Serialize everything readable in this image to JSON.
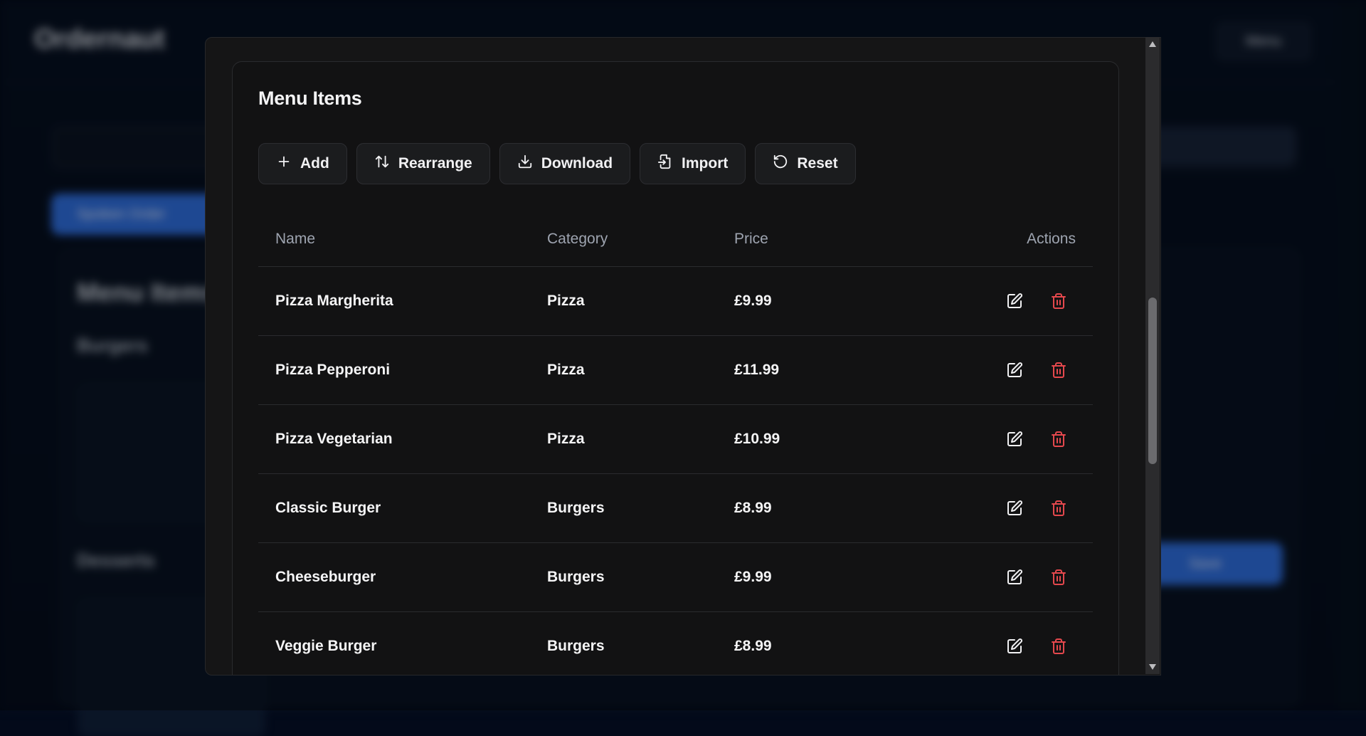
{
  "background": {
    "logo": "Ordernaut",
    "menu_button": "Menu",
    "spoken_order_button": "Spoken Order",
    "panel_title": "Menu Items",
    "sections": [
      "Burgers",
      "Desserts"
    ],
    "save_button": "Save"
  },
  "modal": {
    "title": "Menu Items",
    "toolbar": {
      "add": "Add",
      "rearrange": "Rearrange",
      "download": "Download",
      "import": "Import",
      "reset": "Reset"
    },
    "table": {
      "headers": {
        "name": "Name",
        "category": "Category",
        "price": "Price",
        "actions": "Actions"
      },
      "rows": [
        {
          "name": "Pizza Margherita",
          "category": "Pizza",
          "price": "£9.99"
        },
        {
          "name": "Pizza Pepperoni",
          "category": "Pizza",
          "price": "£11.99"
        },
        {
          "name": "Pizza Vegetarian",
          "category": "Pizza",
          "price": "£10.99"
        },
        {
          "name": "Classic Burger",
          "category": "Burgers",
          "price": "£8.99"
        },
        {
          "name": "Cheeseburger",
          "category": "Burgers",
          "price": "£9.99"
        },
        {
          "name": "Veggie Burger",
          "category": "Burgers",
          "price": "£8.99"
        }
      ]
    }
  },
  "icons": {
    "add": "plus-icon",
    "rearrange": "arrow-up-down-icon",
    "download": "download-icon",
    "import": "import-icon",
    "reset": "rotate-ccw-icon",
    "edit": "edit-icon",
    "delete": "trash-icon"
  },
  "colors": {
    "primary_blue": "#2f6fe0",
    "delete_red": "#e5484d",
    "modal_bg": "#121213"
  }
}
